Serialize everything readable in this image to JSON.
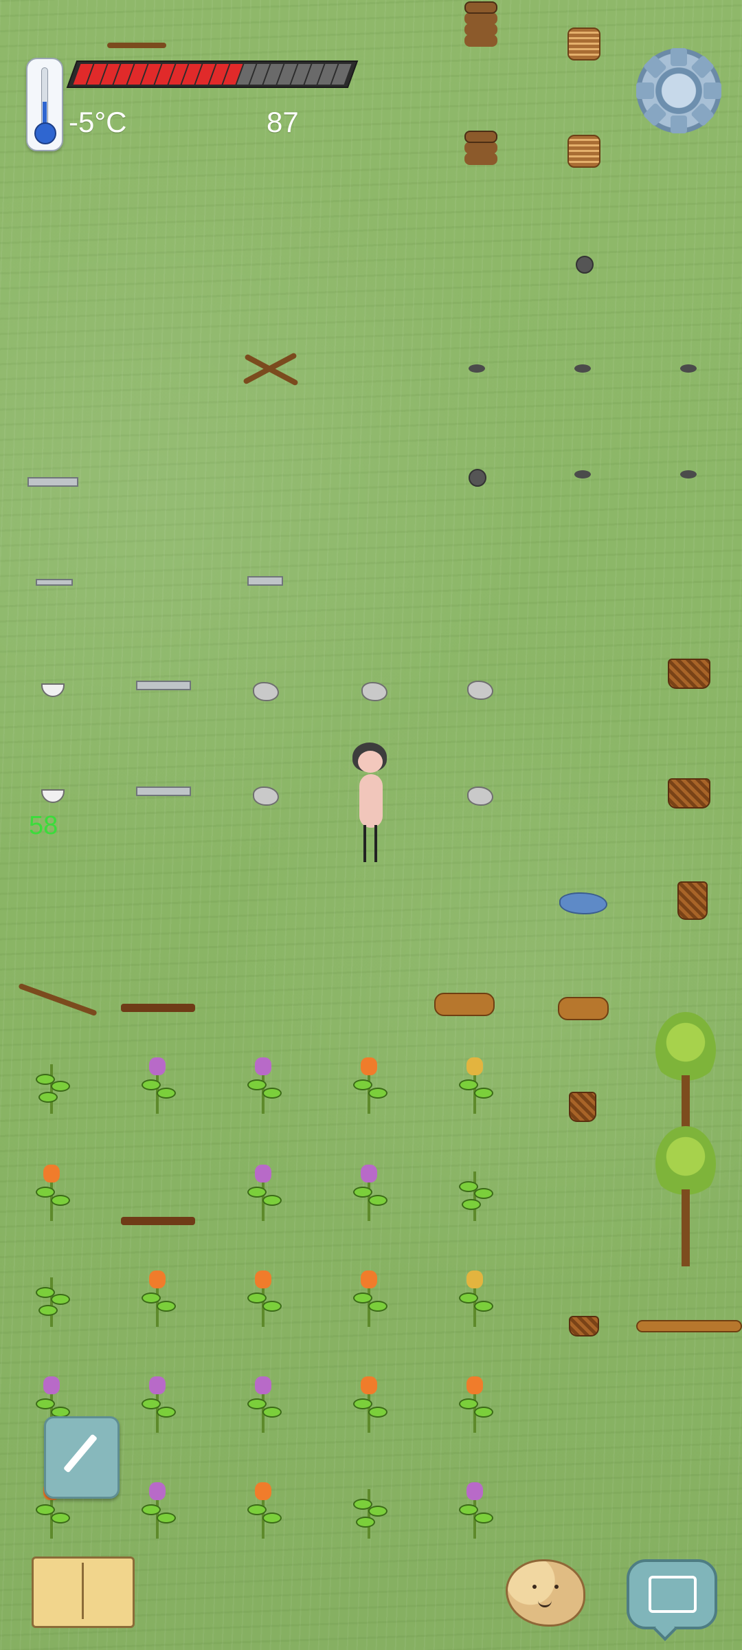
{
  "hud": {
    "temperature": "-5°C",
    "count": "87",
    "green_value": "58",
    "health_segments_total": 20,
    "health_segments_filled": 12
  },
  "icons": {
    "thermometer": "thermometer-icon",
    "settings": "gear-icon",
    "edit": "pencil-icon",
    "journal": "book-icon",
    "emote": "potato-face-icon",
    "keyboard": "keyboard-icon"
  },
  "colors": {
    "health_fill": "#e12a2a",
    "health_empty": "#6a6a6a",
    "green_text": "#3bdc3b",
    "ground": "#8cb768"
  }
}
